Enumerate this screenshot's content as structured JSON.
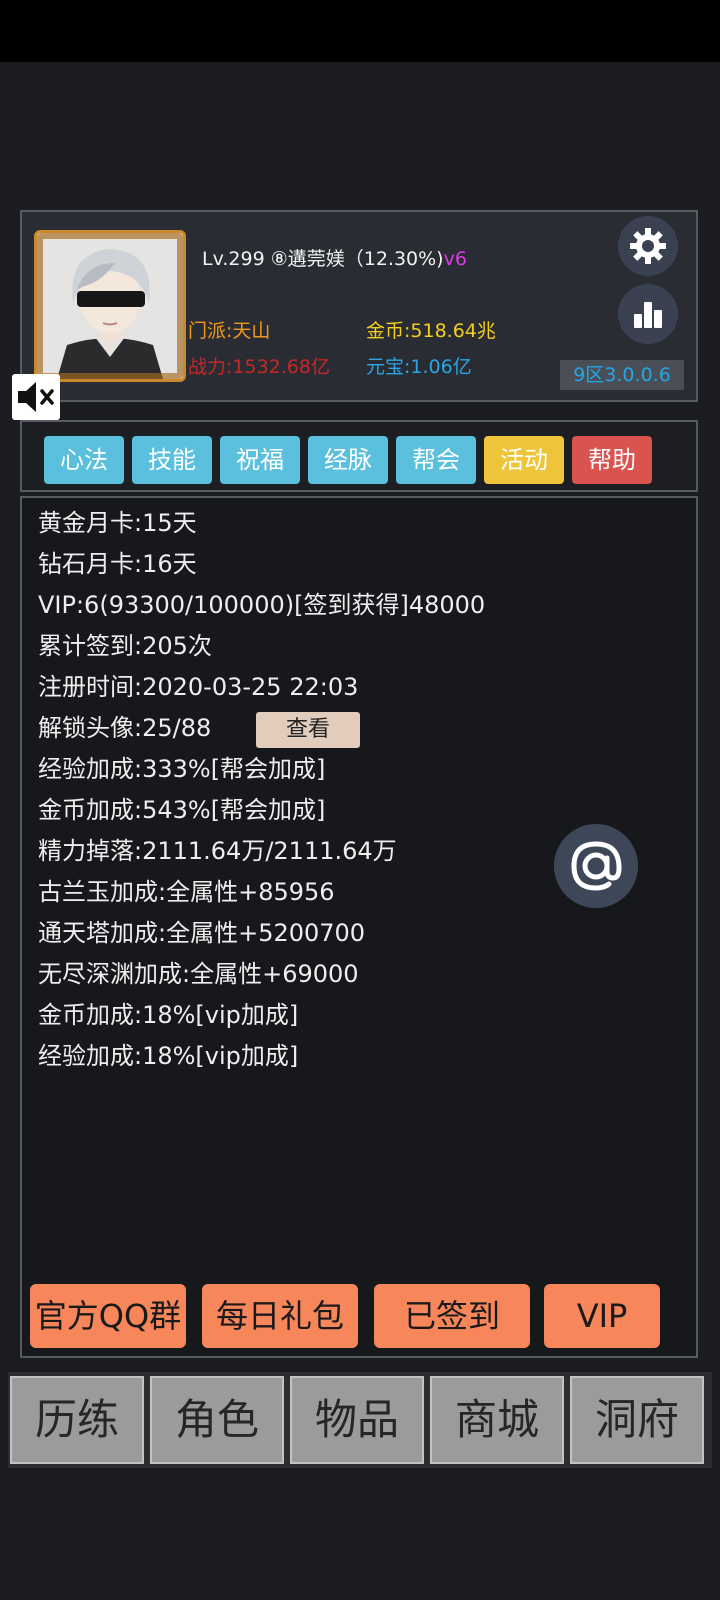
{
  "header": {
    "player_line": "Lv.299 ⑧遘莞媄（12.30%)",
    "vip_tag": "v6",
    "sect": "门派:天山",
    "gold": "金币:518.64兆",
    "power": "战力:1532.68亿",
    "ingot": "元宝:1.06亿",
    "server": "9区3.0.0.6"
  },
  "tabs": [
    {
      "label": "心法",
      "color": "#5bc0de"
    },
    {
      "label": "技能",
      "color": "#5bc0de"
    },
    {
      "label": "祝福",
      "color": "#5bc0de"
    },
    {
      "label": "经脉",
      "color": "#5bc0de"
    },
    {
      "label": "帮会",
      "color": "#5bc0de"
    },
    {
      "label": "活动",
      "color": "#eec53a"
    },
    {
      "label": "帮助",
      "color": "#d9534f"
    }
  ],
  "info": {
    "lines": [
      "黄金月卡:15天",
      "钻石月卡:16天",
      "VIP:6(93300/100000)[签到获得]48000",
      "累计签到:205次",
      "注册时间:2020-03-25 22:03",
      "解锁头像:25/88",
      "经验加成:333%[帮会加成]",
      "金币加成:543%[帮会加成]",
      "精力掉落:2111.64万/2111.64万",
      "古兰玉加成:全属性+85956",
      "通天塔加成:全属性+5200700",
      "无尽深渊加成:全属性+69000",
      "金币加成:18%[vip加成]",
      "经验加成:18%[vip加成]"
    ],
    "view_button": "查看"
  },
  "actions": {
    "qq_group": "官方QQ群",
    "daily_gift": "每日礼包",
    "signed_in": "已签到",
    "vip": "VIP"
  },
  "nav": [
    "历练",
    "角色",
    "物品",
    "商城",
    "洞府"
  ],
  "icons": {
    "settings": "gear-icon",
    "stats": "bar-chart-icon",
    "mute": "speaker-muted-icon",
    "contact": "at-sign-icon"
  }
}
